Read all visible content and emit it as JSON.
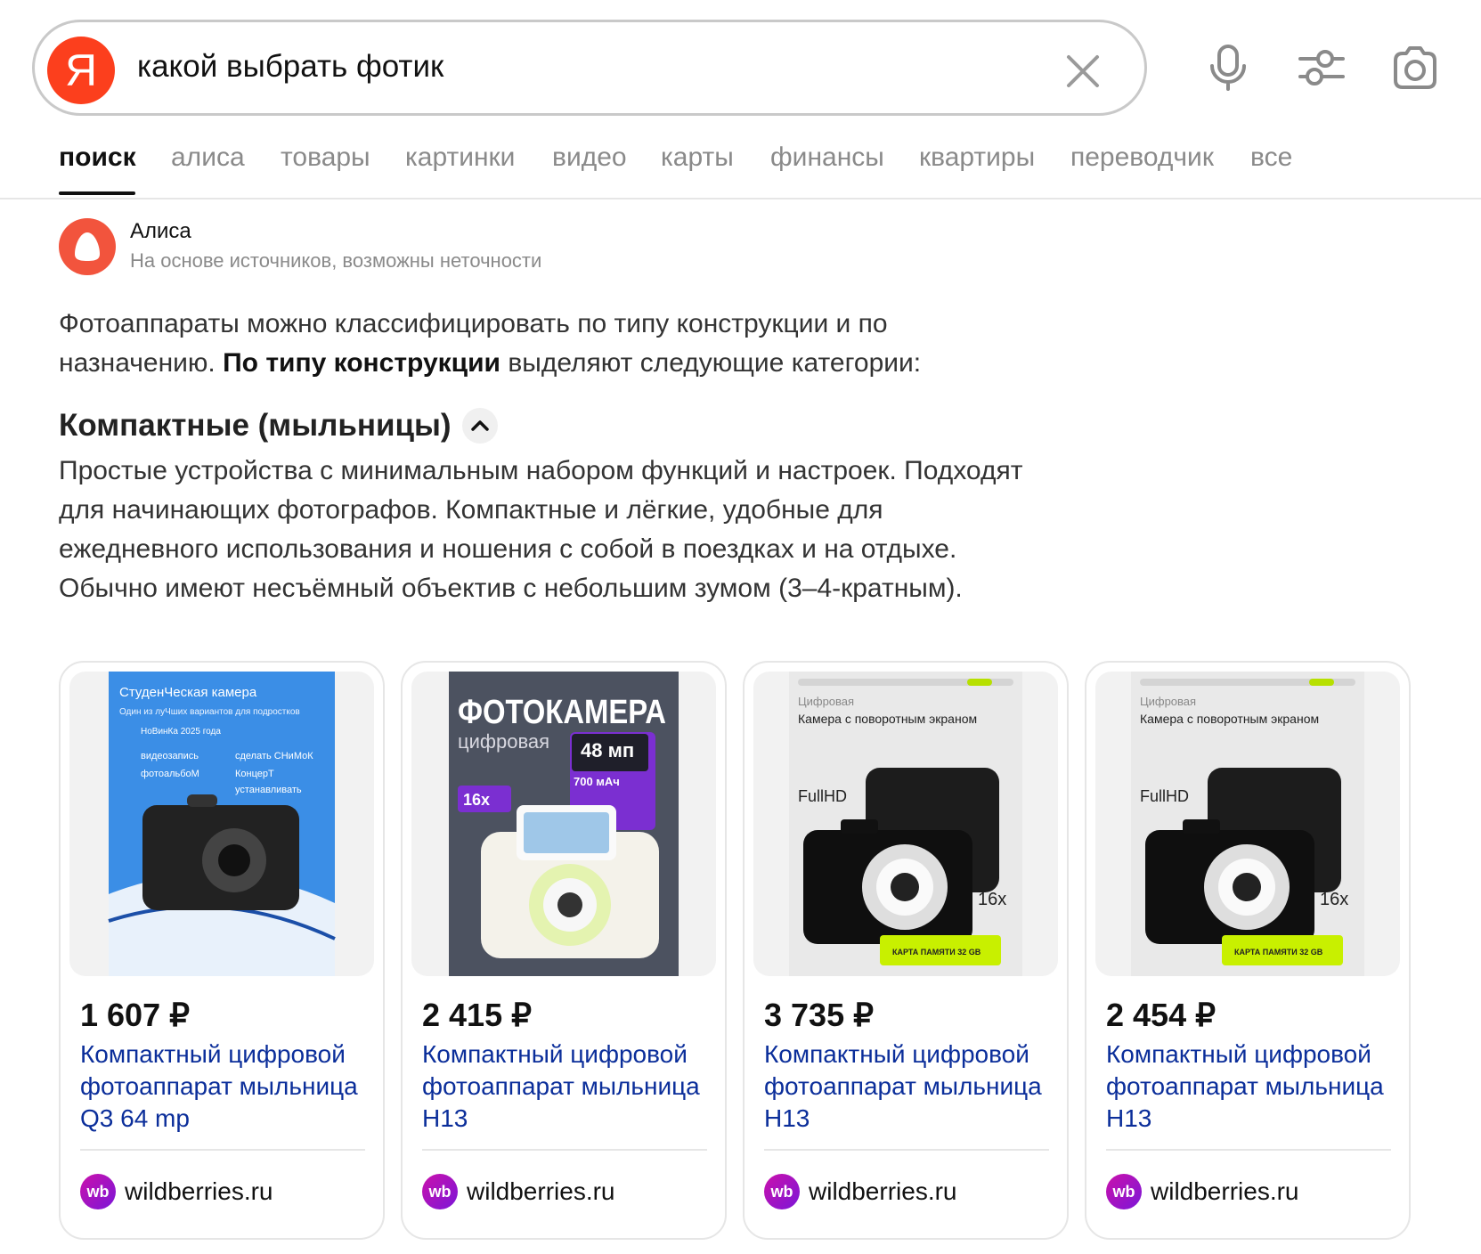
{
  "search": {
    "logo_letter": "Я",
    "query": "какой выбрать фотик",
    "icons": {
      "clear": "close-icon",
      "voice": "microphone-icon",
      "filters": "settings-sliders-icon",
      "image_search": "camera-icon"
    }
  },
  "tabs": [
    {
      "label": "поиск",
      "active": true
    },
    {
      "label": "алиса"
    },
    {
      "label": "товары"
    },
    {
      "label": "картинки"
    },
    {
      "label": "видео"
    },
    {
      "label": "карты"
    },
    {
      "label": "финансы"
    },
    {
      "label": "квартиры"
    },
    {
      "label": "переводчик"
    },
    {
      "label": "все"
    }
  ],
  "alice": {
    "name": "Алиса",
    "subtitle": "На основе источников, возможны неточности",
    "intro_1": "Фотоаппараты можно классифицировать по типу конструкции и по назначению.",
    "intro_bold": "По типу конструкции",
    "intro_2": "выделяют следующие категории:",
    "section_title": "Компактные (мыльницы)",
    "section_text": "Простые устройства с минимальным набором функций и настроек. Подходят для начинающих фотографов. Компактные и лёгкие, удобные для ежедневного использования и ношения с собой в поездках и на отдыхе. Обычно имеют несъёмный объектив с небольшим зумом (3–4-кратным)."
  },
  "products": [
    {
      "price": "1 607 ₽",
      "title": "Компактный цифровой фотоаппарат мыльница Q3 64 mp",
      "shop": "wildberries.ru",
      "image": {
        "heading": "СтуденЧеская камера",
        "sub": "Один из луЧших вариантов для подростков",
        "badge": "НоВинКа 2025 года",
        "features": [
          "видеозапись",
          "сделать СНиМоК",
          "фотоальбоМ",
          "КонцерТ",
          "устанавливать"
        ]
      }
    },
    {
      "price": "2 415 ₽",
      "title": "Компактный цифровой фотоаппарат мыльница H13",
      "shop": "wildberries.ru",
      "image": {
        "heading": "ФОТОКАМЕРА",
        "sub": "цифровая",
        "mp": "48 мп",
        "battery": "700 мАч",
        "zoom": "16x"
      }
    },
    {
      "price": "3 735 ₽",
      "title": "Компактный цифровой фотоаппарат мыльница H13",
      "shop": "wildberries.ru",
      "image": {
        "kicker": "Цифровая",
        "heading": "Камера с поворотным экраном",
        "fullhd": "FullHD",
        "zoom": "16x",
        "card": "КАРТА ПАМЯТИ 32 GB"
      }
    },
    {
      "price": "2 454 ₽",
      "title": "Компактный цифровой фотоаппарат мыльница H13",
      "shop": "wildberries.ru",
      "image": {
        "kicker": "Цифровая",
        "heading": "Камера с поворотным экраном",
        "fullhd": "FullHD",
        "zoom": "16x",
        "card": "КАРТА ПАМЯТИ 32 GB"
      }
    }
  ],
  "colors": {
    "brand_red": "#fc3f1d",
    "link_blue": "#0b2e9a",
    "wb_purple": "#a012c8",
    "lime": "#c8f000"
  }
}
